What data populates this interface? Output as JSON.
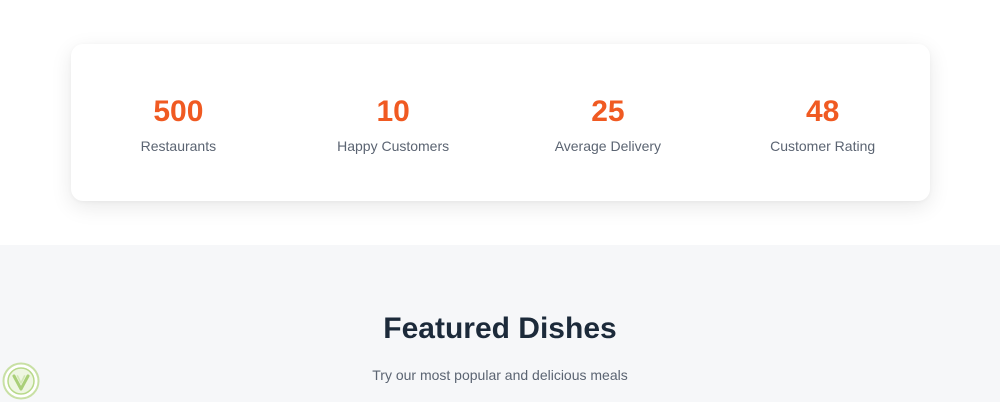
{
  "stats": [
    {
      "value": "500",
      "label": "Restaurants"
    },
    {
      "value": "10",
      "label": "Happy Customers"
    },
    {
      "value": "25",
      "label": "Average Delivery"
    },
    {
      "value": "48",
      "label": "Customer Rating"
    }
  ],
  "featured": {
    "title": "Featured Dishes",
    "subtitle": "Try our most popular and delicious meals"
  },
  "colors": {
    "accent": "#f05a22",
    "heading": "#1c2a3a",
    "muted_text": "#5b6472",
    "section_bg": "#f6f7f9",
    "badge": "#b8d98a"
  },
  "icons": {
    "corner_badge": "shield-check-icon"
  }
}
